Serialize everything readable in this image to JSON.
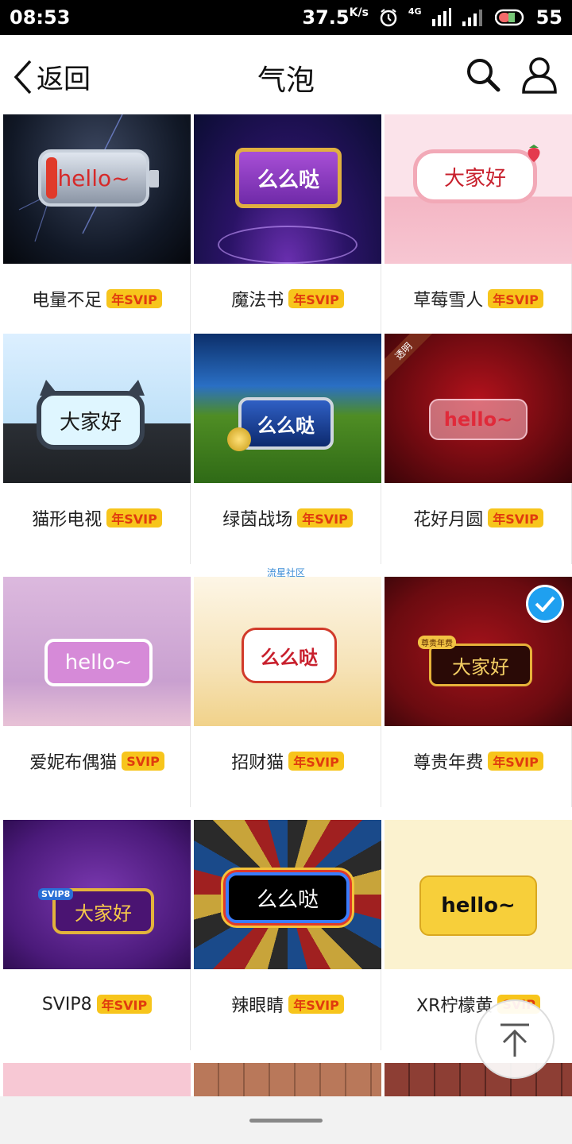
{
  "status": {
    "time": "08:53",
    "speed": "37.5",
    "speed_unit": "K/s",
    "network": "4G",
    "battery": "55"
  },
  "nav": {
    "back_label": "返回",
    "title": "气泡"
  },
  "watermark": "流星社区",
  "transparent_tag": "透明",
  "items": [
    {
      "name": "电量不足",
      "badge": "年SVIP",
      "bubble_text": "hello~"
    },
    {
      "name": "魔法书",
      "badge": "年SVIP",
      "bubble_text": "么么哒"
    },
    {
      "name": "草莓雪人",
      "badge": "年SVIP",
      "bubble_text": "大家好"
    },
    {
      "name": "猫形电视",
      "badge": "年SVIP",
      "bubble_text": "大家好"
    },
    {
      "name": "绿茵战场",
      "badge": "年SVIP",
      "bubble_text": "么么哒"
    },
    {
      "name": "花好月圆",
      "badge": "年SVIP",
      "bubble_text": "hello~"
    },
    {
      "name": "爱妮布偶猫",
      "badge": "SVIP",
      "bubble_text": "hello~"
    },
    {
      "name": "招财猫",
      "badge": "年SVIP",
      "bubble_text": "么么哒"
    },
    {
      "name": "尊贵年费",
      "badge": "年SVIP",
      "bubble_text": "大家好",
      "crown_text": "尊贵年费"
    },
    {
      "name": "SVIP8",
      "badge": "年SVIP",
      "bubble_text": "大家好",
      "crown_text": "SVIP8"
    },
    {
      "name": "辣眼睛",
      "badge": "年SVIP",
      "bubble_text": "么么哒"
    },
    {
      "name": "XR柠檬黄",
      "badge": "SVIP",
      "bubble_text": "hello~"
    }
  ],
  "colors": {
    "badge_bg": "#f7c51c",
    "badge_text": "#e03b0e",
    "selected_check": "#1fa0f0"
  }
}
